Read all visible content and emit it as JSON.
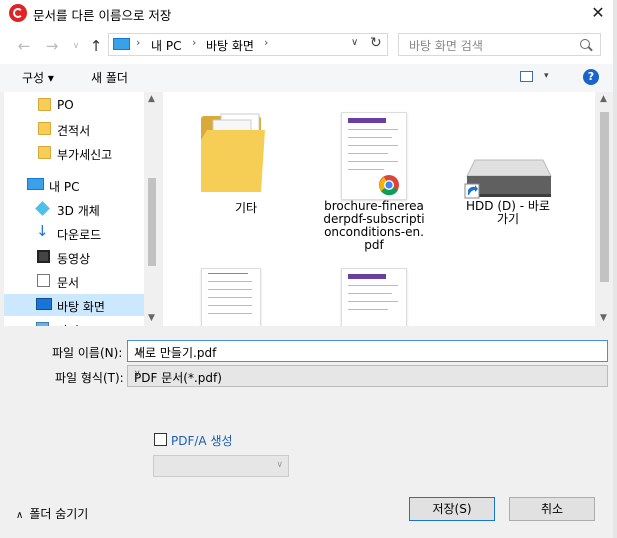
{
  "window": {
    "title": "문서를 다른 이름으로 저장",
    "close_glyph": "✕"
  },
  "address": {
    "segments": [
      "내 PC",
      "바탕 화면"
    ],
    "separator": "›"
  },
  "search": {
    "placeholder": "바탕 화면 검색"
  },
  "toolbar": {
    "organize": "구성 ▾",
    "new_folder": "새 폴더",
    "help": "?"
  },
  "nav": {
    "items": [
      {
        "label": "PO",
        "icon": "folder-icon"
      },
      {
        "label": "견적서",
        "icon": "folder-icon"
      },
      {
        "label": "부가세신고",
        "icon": "folder-icon"
      },
      {
        "label": "내 PC",
        "icon": "pc-icon"
      },
      {
        "label": "3D 개체",
        "icon": "3d-objects-icon"
      },
      {
        "label": "다운로드",
        "icon": "download-icon"
      },
      {
        "label": "동영상",
        "icon": "video-icon"
      },
      {
        "label": "문서",
        "icon": "document-icon"
      },
      {
        "label": "바탕 화면",
        "icon": "desktop-icon",
        "selected": true
      },
      {
        "label": "사진",
        "icon": "pictures-icon"
      }
    ]
  },
  "files": [
    {
      "name": "기타",
      "icon": "folder-icon"
    },
    {
      "name": "brochure-finereaderpdf-subscriptionconditions-en.pdf",
      "name_lines": [
        "brochure-finerea",
        "derpdf-subscripti",
        "onconditions-en.",
        "pdf"
      ],
      "icon": "pdf-chrome-icon"
    },
    {
      "name": "HDD (D) - 바로 가기",
      "name_lines": [
        "HDD (D) - 바로",
        "가기"
      ],
      "icon": "drive-shortcut-icon"
    }
  ],
  "form": {
    "filename_label": "파일 이름(N):",
    "filename_value": "새로 만들기.pdf",
    "filetype_label": "파일 형식(T):",
    "filetype_value": "PDF 문서(*.pdf)",
    "pdfa_label": "PDF/A 생성",
    "pdfa_checked": false,
    "hide_folders": "폴더 숨기기",
    "save": "저장(S)",
    "cancel": "취소"
  },
  "colors": {
    "accent": "#1a74d6",
    "selection": "#cce8ff",
    "app_icon": "#e02424"
  }
}
